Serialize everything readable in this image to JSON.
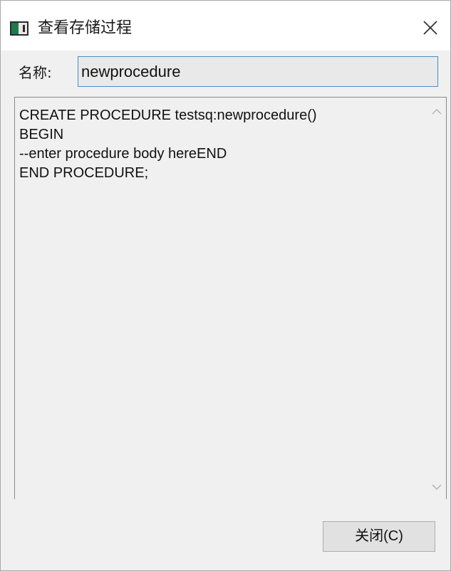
{
  "window": {
    "title": "查看存储过程",
    "icon": "app-window-icon",
    "close_icon": "close-icon"
  },
  "form": {
    "name_label": "名称:",
    "name_value": "newprocedure"
  },
  "editor": {
    "lines": [
      "CREATE PROCEDURE testsq:newprocedure()",
      "BEGIN",
      "--enter procedure body hereEND",
      "END PROCEDURE;"
    ],
    "scroll_up_icon": "chevron-up-icon",
    "scroll_down_icon": "chevron-down-icon"
  },
  "buttons": {
    "close_label": "关闭(C)"
  },
  "colors": {
    "field_border": "#4a8ec8",
    "icon_accent": "#1e7a4c"
  }
}
